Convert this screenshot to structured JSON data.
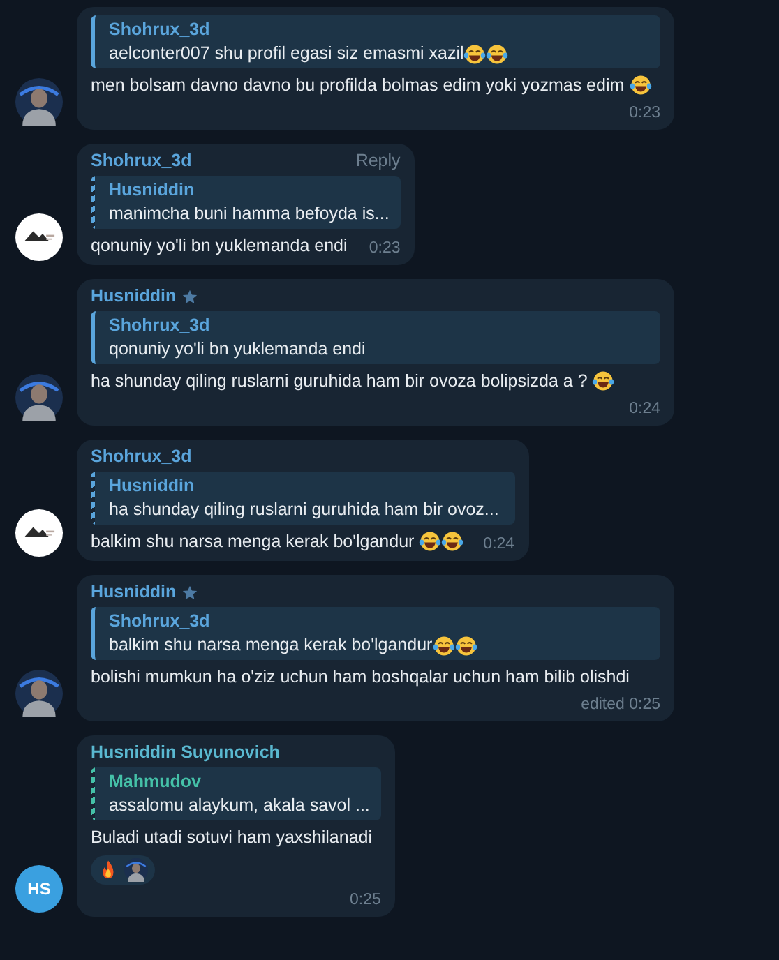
{
  "messages": [
    {
      "avatar": {
        "kind": "photo"
      },
      "quote": {
        "author": "Shohrux_3d",
        "color": "#5aa5dc",
        "striped": false,
        "text": "aelconter007 shu profil egasi siz emasmi xazil",
        "emojis": [
          {
            "kind": "laugh"
          },
          {
            "kind": "laugh"
          }
        ]
      },
      "text": "men bolsam davno davno bu profilda bolmas edim yoki yozmas edim",
      "emojis": [
        {
          "kind": "laugh"
        }
      ],
      "time": "0:23"
    },
    {
      "avatar": {
        "kind": "logo"
      },
      "sender": {
        "name": "Shohrux_3d",
        "color": "#5aa5dc",
        "starred": false
      },
      "action": "Reply",
      "quote": {
        "author": "Husniddin",
        "color": "#5aa5dc",
        "striped": true,
        "text": "manimcha buni hamma befoyda is..."
      },
      "text": "qonuniy yo'li bn yuklemanda endi",
      "time": "0:23"
    },
    {
      "avatar": {
        "kind": "photo"
      },
      "sender": {
        "name": "Husniddin",
        "color": "#5aa5dc",
        "starred": true
      },
      "quote": {
        "author": "Shohrux_3d",
        "color": "#5aa5dc",
        "striped": false,
        "text": "qonuniy yo'li bn yuklemanda endi"
      },
      "text": "ha shunday qiling ruslarni guruhida ham bir ovoza bolipsizda a ?",
      "emojis": [
        {
          "kind": "laugh"
        }
      ],
      "time": "0:24"
    },
    {
      "avatar": {
        "kind": "logo"
      },
      "sender": {
        "name": "Shohrux_3d",
        "color": "#5aa5dc",
        "starred": false
      },
      "quote": {
        "author": "Husniddin",
        "color": "#5aa5dc",
        "striped": true,
        "text": "ha shunday qiling ruslarni guruhida ham bir ovoz..."
      },
      "text": "balkim shu narsa menga kerak bo'lgandur",
      "emojis": [
        {
          "kind": "laugh"
        },
        {
          "kind": "laugh"
        }
      ],
      "time": "0:24"
    },
    {
      "avatar": {
        "kind": "photo"
      },
      "sender": {
        "name": "Husniddin",
        "color": "#5aa5dc",
        "starred": true
      },
      "quote": {
        "author": "Shohrux_3d",
        "color": "#5aa5dc",
        "striped": false,
        "text": "balkim shu narsa menga kerak bo'lgandur",
        "emojis": [
          {
            "kind": "laugh"
          },
          {
            "kind": "laugh"
          }
        ]
      },
      "text": "bolishi mumkun  ha o'ziz uchun ham boshqalar uchun ham bilib olishdi",
      "time": "edited 0:25"
    },
    {
      "avatar": {
        "kind": "initials",
        "initials": "HS"
      },
      "sender": {
        "name": "Husniddin Suyunovich",
        "color": "#5ab8d0",
        "starred": false
      },
      "quote": {
        "author": "Mahmudov",
        "color": "#45c1a8",
        "striped": true,
        "text": "assalomu alaykum, akala savol ..."
      },
      "text": "Buladi utadi sotuvi ham yaxshilanadi",
      "reactions": [
        {
          "kind": "fire"
        }
      ],
      "time": "0:25"
    }
  ]
}
